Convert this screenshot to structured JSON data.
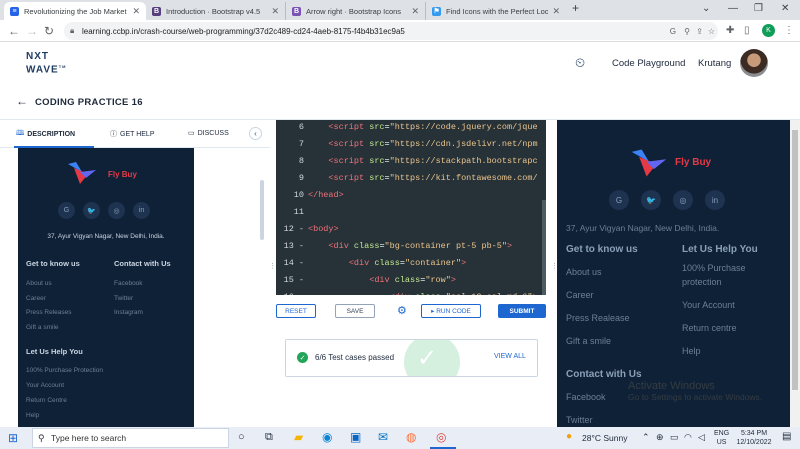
{
  "browser": {
    "tabs": [
      {
        "title": "Revolutionizing the Job Market |",
        "fav_color": "#2563eb",
        "fav_char": "≡"
      },
      {
        "title": "Introduction · Bootstrap v4.5",
        "fav_color": "#563d7c",
        "fav_char": "B"
      },
      {
        "title": "Arrow right · Bootstrap Icons",
        "fav_color": "#7952b3",
        "fav_char": "B"
      },
      {
        "title": "Find Icons with the Perfect Look",
        "fav_color": "#339af0",
        "fav_char": "⚑"
      }
    ],
    "new_tab": "+",
    "url": "learning.ccbp.in/crash-course/web-programming/37d2c489-cd24-4aeb-8175-f4b4b31ec9a5",
    "profile_initial": "K"
  },
  "app": {
    "logo_top": "NXT",
    "logo_bottom": "WAVE",
    "logo_tm": "TM",
    "playground": "Code Playground",
    "user": "Krutang",
    "title": "CODING PRACTICE 16"
  },
  "left_tabs": {
    "description": "DESCRIPTION",
    "help": "GET HELP",
    "discuss": "DISCUSS"
  },
  "site": {
    "brand": "Fly Buy",
    "address": "37, Ayur Vigyan Nagar, New Delhi, India.",
    "social": [
      "G",
      "🐦",
      "◎",
      "in"
    ],
    "col1_title": "Get to know us",
    "col1": [
      "About us",
      "Career",
      "Press Releases",
      "Gift a smile"
    ],
    "col1_right": [
      "About us",
      "Career",
      "Press Realease",
      "Gift a smile"
    ],
    "col2_title": "Contact with Us",
    "col2": [
      "Facebook",
      "Twitter",
      "Instagram"
    ],
    "col3_title": "Let Us Help You",
    "col3": [
      "100% Purchase Protection",
      "Your Account",
      "Return Centre",
      "Help"
    ],
    "col3_right": [
      "100% Purchase protection",
      "Your Account",
      "Return centre",
      "Help"
    ],
    "col4_title": "Contact with Us",
    "col4": [
      "Facebook",
      "Twitter"
    ]
  },
  "editor": {
    "lines": [
      {
        "n": "6",
        "html": "    <span class='t'>&lt;script</span> <span class='a'>src</span>=<span class='s'>\"https://code.jquery.com/jque</span>"
      },
      {
        "n": "7",
        "html": "    <span class='t'>&lt;script</span> <span class='a'>src</span>=<span class='s'>\"https://cdn.jsdelivr.net/npm</span>"
      },
      {
        "n": "8",
        "html": "    <span class='t'>&lt;script</span> <span class='a'>src</span>=<span class='s'>\"https://stackpath.bootstrapc</span>"
      },
      {
        "n": "9",
        "html": "    <span class='t'>&lt;script</span> <span class='a'>src</span>=<span class='s'>\"https://kit.fontawesome.com/</span>"
      },
      {
        "n": "10",
        "html": "<span class='t'>&lt;/head&gt;</span>"
      },
      {
        "n": "11",
        "html": ""
      },
      {
        "n": "12 -",
        "html": "<span class='t'>&lt;body&gt;</span>"
      },
      {
        "n": "13 -",
        "html": "    <span class='t'>&lt;div</span> <span class='a'>class</span>=<span class='s'>\"bg-container pt-5 pb-5\"</span><span class='t'>&gt;</span>"
      },
      {
        "n": "14 -",
        "html": "        <span class='t'>&lt;div</span> <span class='a'>class</span>=<span class='s'>\"container\"</span><span class='t'>&gt;</span>"
      },
      {
        "n": "15 -",
        "html": "            <span class='t'>&lt;div</span> <span class='a'>class</span>=<span class='s'>\"row\"</span><span class='t'>&gt;</span>"
      },
      {
        "n": "16 -",
        "html": "                <span class='t'>&lt;div</span> <span class='a'>class</span>=<span class='s'>\"col-12 col-md-6\"</span><span class='t'>&gt;</span>"
      }
    ]
  },
  "buttons": {
    "reset": "RESET",
    "save": "SAVE",
    "run": "▸ RUN CODE",
    "submit": "SUBMIT"
  },
  "tests": {
    "text": "6/6 Test cases passed",
    "view_all": "VIEW ALL"
  },
  "watermark": {
    "line1": "Activate Windows",
    "line2": "Go to Settings to activate Windows."
  },
  "taskbar": {
    "search": "Type here to search",
    "weather": "28°C  Sunny",
    "lang1": "ENG",
    "lang2": "US",
    "time": "5:34 PM",
    "date": "12/10/2022"
  },
  "colors": {
    "accent": "#1e66d0",
    "navy": "#0f2137",
    "brand_red": "#e63946",
    "success": "#22a559"
  }
}
